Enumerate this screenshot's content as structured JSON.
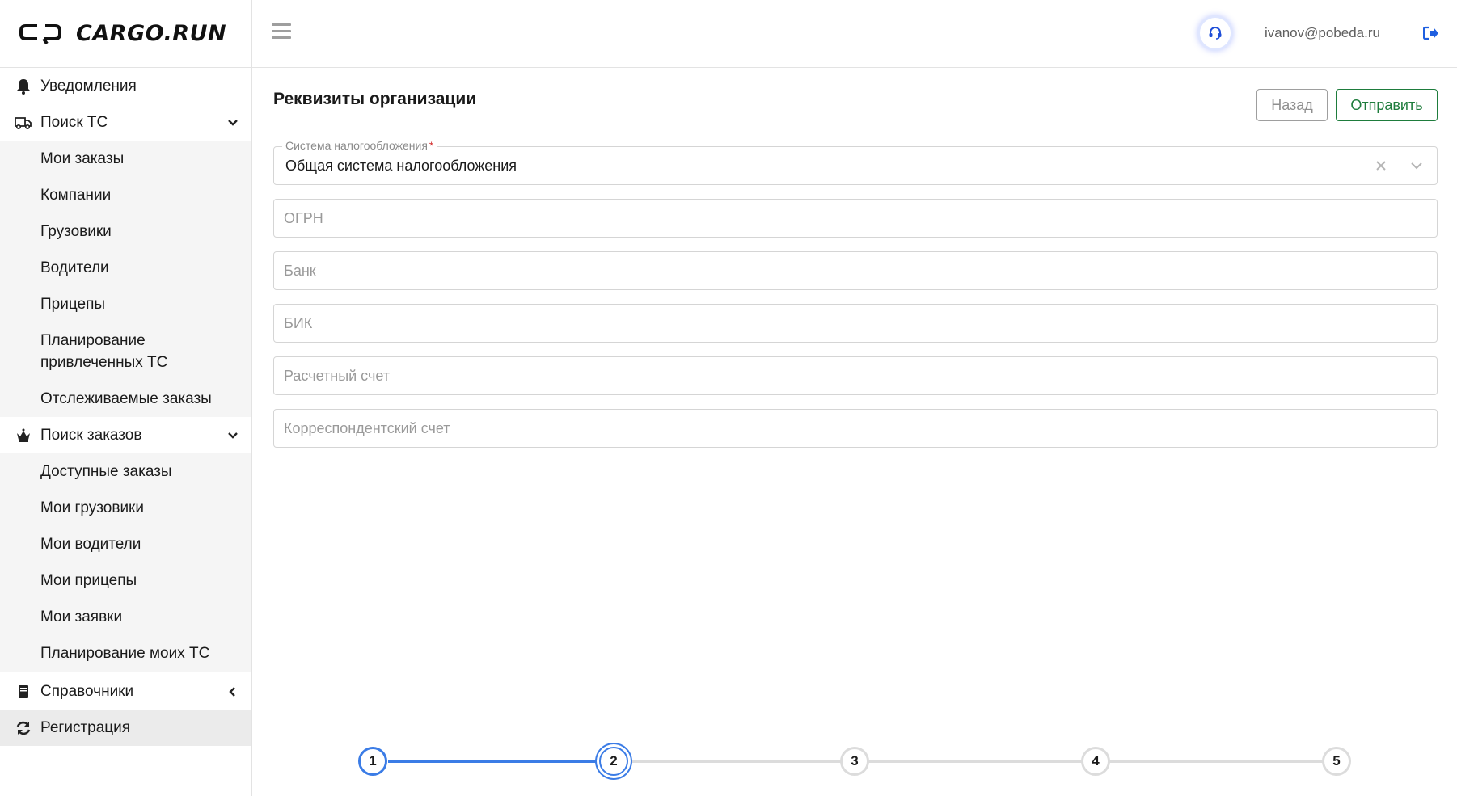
{
  "brand": {
    "logo_text": "CARGO.RUN"
  },
  "header": {
    "user_email": "ivanov@pobeda.ru"
  },
  "sidebar": {
    "notifications": "Уведомления",
    "vehicle_search": "Поиск ТС",
    "vehicle_search_items": [
      "Мои заказы",
      "Компании",
      "Грузовики",
      "Водители",
      "Прицепы",
      "Планирование\nпривлеченных ТС",
      "Отслеживаемые заказы"
    ],
    "order_search": "Поиск заказов",
    "order_search_items": [
      "Доступные заказы",
      "Мои грузовики",
      "Мои водители",
      "Мои прицепы",
      "Мои заявки",
      "Планирование моих ТС"
    ],
    "directories": "Справочники",
    "registration": "Регистрация"
  },
  "main": {
    "title": "Реквизиты организации",
    "back_label": "Назад",
    "send_label": "Отправить",
    "tax_system": {
      "label": "Система налогообложения",
      "required_mark": "*",
      "value": "Общая система налогообложения"
    },
    "fields": {
      "ogrn": {
        "placeholder": "ОГРН",
        "value": ""
      },
      "bank": {
        "placeholder": "Банк",
        "value": ""
      },
      "bik": {
        "placeholder": "БИК",
        "value": ""
      },
      "account": {
        "placeholder": "Расчетный счет",
        "value": ""
      },
      "corr_account": {
        "placeholder": "Корреспондентский счет",
        "value": ""
      }
    }
  },
  "stepper": {
    "steps": [
      "1",
      "2",
      "3",
      "4",
      "5"
    ],
    "current": 2,
    "completed": [
      1
    ]
  },
  "colors": {
    "accent_blue": "#3b7ce6",
    "send_green": "#1e7c3c",
    "inactive_line": "#dcdcdc",
    "required_red": "#d32f2f"
  }
}
